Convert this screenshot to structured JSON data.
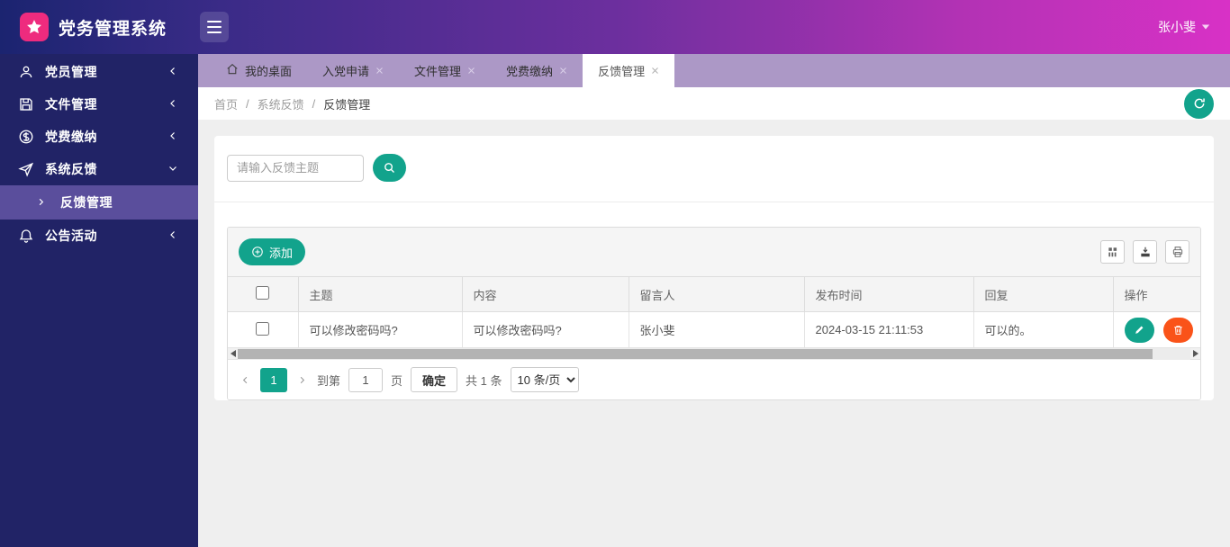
{
  "app": {
    "title": "党务管理系统",
    "user": "张小斐"
  },
  "colors": {
    "header_gradient_from": "#1b2470",
    "header_gradient_to": "#d831c6",
    "logo_pink": "#ee2b7e",
    "sidebar_bg": "#212366",
    "sidebar_active_bg": "#5a4e9c",
    "tabbar_bg": "#ac98c6",
    "teal_accent": "#12a38c",
    "danger_orange": "#fa5319",
    "page_bg": "#efefef"
  },
  "sidebar": {
    "items": [
      {
        "label": "党员管理",
        "icon": "user-icon",
        "state": "collapsed"
      },
      {
        "label": "文件管理",
        "icon": "save-icon",
        "state": "collapsed"
      },
      {
        "label": "党费缴纳",
        "icon": "dollar-icon",
        "state": "collapsed"
      },
      {
        "label": "系统反馈",
        "icon": "send-icon",
        "state": "expanded"
      },
      {
        "label": "反馈管理",
        "type": "sub-item",
        "active": true
      },
      {
        "label": "公告活动",
        "icon": "bell-icon",
        "state": "collapsed"
      }
    ]
  },
  "tabs": [
    {
      "label": "我的桌面",
      "icon": "home-icon",
      "closable": false,
      "active": false
    },
    {
      "label": "入党申请",
      "closable": true,
      "active": false
    },
    {
      "label": "文件管理",
      "closable": true,
      "active": false
    },
    {
      "label": "党费缴纳",
      "closable": true,
      "active": false
    },
    {
      "label": "反馈管理",
      "closable": true,
      "active": true
    }
  ],
  "breadcrumb": {
    "items": [
      "首页",
      "系统反馈",
      "反馈管理"
    ],
    "separator": "/"
  },
  "search": {
    "placeholder": "请输入反馈主题"
  },
  "toolbar": {
    "add_label": "添加",
    "icons": [
      "columns-icon",
      "export-icon",
      "print-icon"
    ]
  },
  "table": {
    "columns": [
      "主题",
      "内容",
      "留言人",
      "发布时间",
      "回复",
      "操作"
    ],
    "rows": [
      {
        "subject": "可以修改密码吗?",
        "content": "可以修改密码吗?",
        "author": "张小斐",
        "time": "2024-03-15 21:11:53",
        "reply": "可以的。"
      }
    ]
  },
  "pagination": {
    "current_page": "1",
    "goto_label": "到第",
    "goto_value": "1",
    "page_label": "页",
    "confirm_label": "确定",
    "total_label": "共 1 条",
    "page_size_selected": "10 条/页"
  }
}
